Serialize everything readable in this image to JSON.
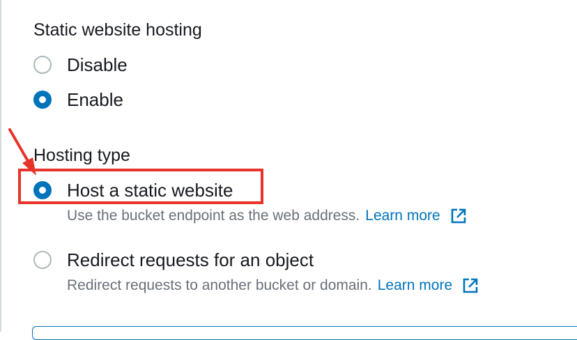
{
  "static_hosting": {
    "label": "Static website hosting",
    "options": [
      {
        "label": "Disable",
        "selected": false
      },
      {
        "label": "Enable",
        "selected": true
      }
    ]
  },
  "hosting_type": {
    "label": "Hosting type",
    "options": [
      {
        "label": "Host a static website",
        "selected": true,
        "description": "Use the bucket endpoint as the web address.",
        "link": "Learn more"
      },
      {
        "label": "Redirect requests for an object",
        "selected": false,
        "description": "Redirect requests to another bucket or domain.",
        "link": "Learn more"
      }
    ]
  },
  "colors": {
    "accent": "#0073bb",
    "annotation": "#e8332a",
    "text": "#16191f",
    "muted": "#687078"
  },
  "icons": [
    "external-link-icon",
    "annotation-arrow"
  ]
}
